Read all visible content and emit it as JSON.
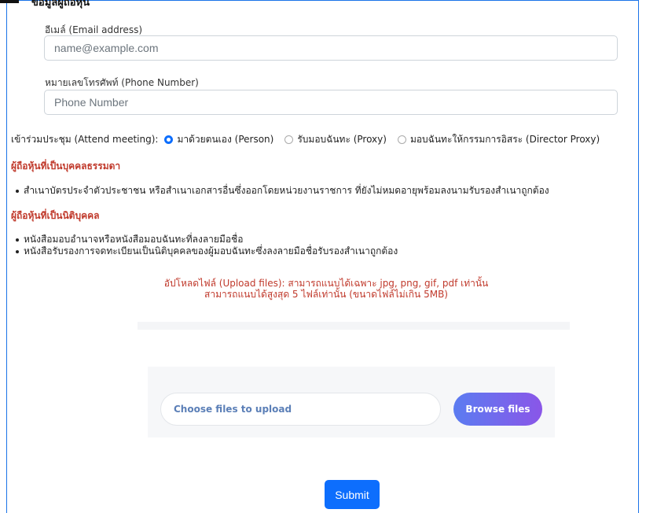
{
  "header": {
    "partial_text": "ข้อมูลผู้ถือหุ้น"
  },
  "email": {
    "label": "อีเมล์ (Email address)",
    "placeholder": "name@example.com"
  },
  "phone": {
    "label": "หมายเลขโทรศัพท์ (Phone Number)",
    "placeholder": "Phone Number"
  },
  "attend": {
    "label": "เข้าร่วมประชุม (Attend meeting):",
    "options": [
      {
        "label": "มาด้วยตนเอง (Person)",
        "checked": true
      },
      {
        "label": "รับมอบฉันทะ (Proxy)",
        "checked": false
      },
      {
        "label": "มอบฉันทะให้กรรมการอิสระ (Director Proxy)",
        "checked": false
      }
    ]
  },
  "natural_person": {
    "heading": "ผู้ถือหุ้นที่เป็นบุคคลธรรมดา",
    "items": [
      "สำเนาบัตรประจำตัวประชาชน หรือสำเนาเอกสารอื่นซึ่งออกโดยหน่วยงานราชการ ที่ยังไม่หมดอายุพร้อมลงนามรับรองสำเนาถูกต้อง"
    ]
  },
  "juristic_person": {
    "heading": "ผู้ถือหุ้นที่เป็นนิติบุคคล",
    "items": [
      "หนังสือมอบอำนาจหรือหนังสือมอบฉันทะที่ลงลายมือชื่อ",
      "หนังสือรับรองการจดทะเบียนเป็นนิติบุคคลของผู้มอบฉันทะซึ่งลงลายมือชื่อรับรองสำเนาถูกต้อง"
    ]
  },
  "upload": {
    "note_line1": "อัปโหลดไฟล์ (Upload files): สามารถแนบได้เฉพาะ jpg, png, gif, pdf เท่านั้น",
    "note_line2": "สามารถแนบได้สูงสุด 5 ไฟล์เท่านั้น (ขนาดไฟล์ไม่เกิน 5MB)",
    "choose_label": "Choose files to upload",
    "browse_label": "Browse files"
  },
  "submit": {
    "label": "Submit"
  },
  "colors": {
    "accent": "#0d6efd",
    "heading_red": "#c0392b",
    "browse_from": "#5b7cf1",
    "browse_to": "#8a56e8"
  }
}
